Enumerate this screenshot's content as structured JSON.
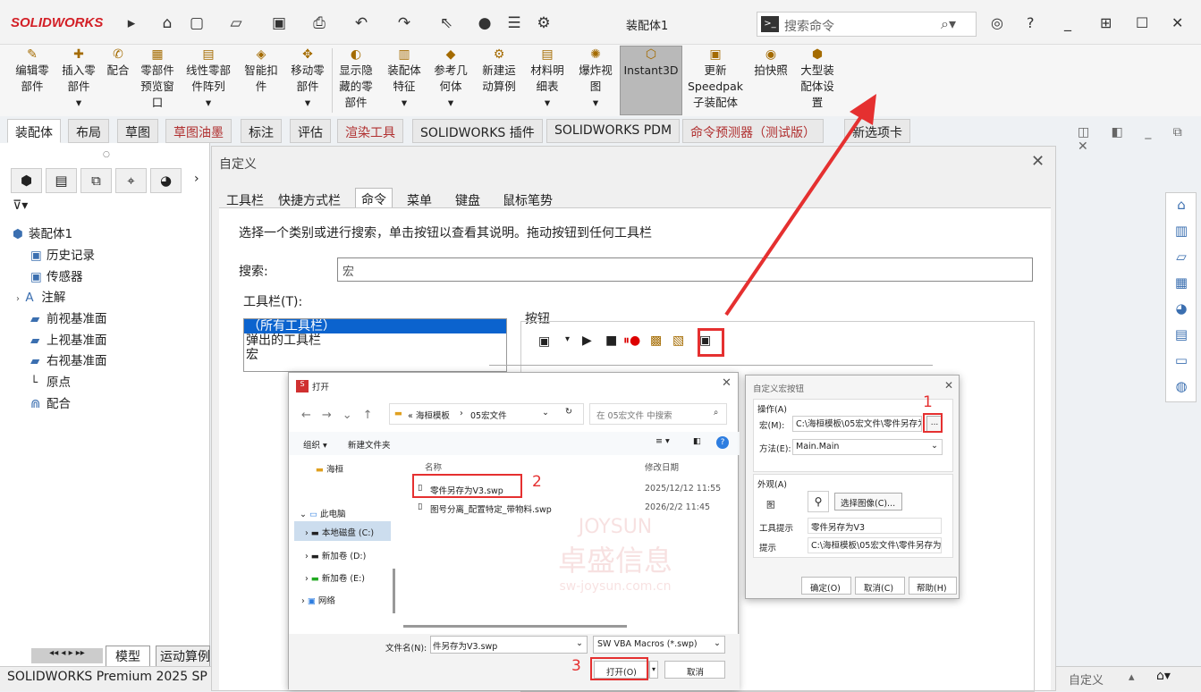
{
  "titlebar": {
    "logo": "SOLIDWORKS",
    "doc_title": "装配体1",
    "search_placeholder": "搜索命令"
  },
  "ribbon": [
    {
      "l1": "编辑零",
      "l2": "部件",
      "l3": ""
    },
    {
      "l1": "插入零",
      "l2": "部件",
      "l3": "▾"
    },
    {
      "l1": "配合",
      "l2": "",
      "l3": ""
    },
    {
      "l1": "零部件",
      "l2": "预览窗",
      "l3": "口"
    },
    {
      "l1": "线性零部",
      "l2": "件阵列",
      "l3": "▾"
    },
    {
      "l1": "智能扣",
      "l2": "件",
      "l3": ""
    },
    {
      "l1": "移动零",
      "l2": "部件",
      "l3": "▾"
    },
    {
      "l1": "显示隐",
      "l2": "藏的零",
      "l3": "部件"
    },
    {
      "l1": "装配体",
      "l2": "特征",
      "l3": "▾"
    },
    {
      "l1": "参考几",
      "l2": "何体",
      "l3": "▾"
    },
    {
      "l1": "新建运",
      "l2": "动算例",
      "l3": ""
    },
    {
      "l1": "材料明",
      "l2": "细表",
      "l3": "▾"
    },
    {
      "l1": "爆炸视",
      "l2": "图",
      "l3": "▾"
    },
    {
      "l1": "Instant3D",
      "l2": "",
      "l3": ""
    },
    {
      "l1": "更新",
      "l2": "Speedpak",
      "l3": "子装配体"
    },
    {
      "l1": "拍快照",
      "l2": "",
      "l3": ""
    },
    {
      "l1": "大型装",
      "l2": "配体设",
      "l3": "置"
    }
  ],
  "tabs": [
    "装配体",
    "布局",
    "草图",
    "草图油墨",
    "标注",
    "评估",
    "渲染工具",
    "SOLIDWORKS 插件",
    "SOLIDWORKS PDM",
    "命令预测器（测试版）",
    "新选项卡"
  ],
  "tree": {
    "root": "装配体1",
    "items": [
      "历史记录",
      "传感器",
      "注解",
      "前视基准面",
      "上视基准面",
      "右视基准面",
      "原点",
      "配合"
    ]
  },
  "bottom_tabs": [
    "模型",
    "运动算例"
  ],
  "status": {
    "product": "SOLIDWORKS Premium 2025 SP",
    "mode": "自定义"
  },
  "customize": {
    "title": "自定义",
    "tabs": [
      "工具栏",
      "快捷方式栏",
      "命令",
      "菜单",
      "键盘",
      "鼠标笔势"
    ],
    "instruction": "选择一个类别或进行搜索，单击按钮以查看其说明。拖动按钮到任何工具栏",
    "search_label": "搜索:",
    "search_value": "宏",
    "toolbar_label": "工具栏(T):",
    "list": [
      "（所有工具栏）",
      "弹出的工具栏",
      "宏"
    ],
    "buttons_label": "按钮"
  },
  "open_dialog": {
    "title": "打开",
    "path": [
      "« 海桓模板",
      "05宏文件"
    ],
    "search_placeholder": "在 05宏文件 中搜索",
    "organize": "组织 ▾",
    "new_folder": "新建文件夹",
    "col_name": "名称",
    "col_date": "修改日期",
    "nav": [
      "海桓",
      "此电脑",
      "本地磁盘 (C:)",
      "新加卷 (D:)",
      "新加卷 (E:)",
      "网络"
    ],
    "files": [
      {
        "name": "零件另存为V3.swp",
        "date": "2025/12/12 11:55"
      },
      {
        "name": "图号分离_配置特定_带物料.swp",
        "date": "2026/2/2 11:45"
      }
    ],
    "filename_label": "文件名(N):",
    "filename_value": "件另存为V3.swp",
    "filter": "SW VBA Macros (*.swp)",
    "open_btn": "打开(O)",
    "cancel_btn": "取消"
  },
  "macro_dialog": {
    "title": "自定义宏按钮",
    "action": "操作(A)",
    "macro_label": "宏(M):",
    "macro_value": "C:\\海桓模板\\05宏文件\\零件另存为",
    "method_label": "方法(E):",
    "method_value": "Main.Main",
    "appearance": "外观(A)",
    "image_label": "图",
    "choose_image": "选择图像(C)...",
    "tooltip_label": "工具提示",
    "tooltip_value": "零件另存为V3",
    "prompt_label": "提示",
    "prompt_value": "C:\\海桓模板\\05宏文件\\零件另存为",
    "ok": "确定(O)",
    "cancel": "取消(C)",
    "help": "帮助(H)"
  },
  "annotations": {
    "n1": "1",
    "n2": "2",
    "n3": "3"
  },
  "watermark": {
    "cn": "卓盛信息",
    "en": "JOYSUN",
    "url": "sw-joysun.com.cn"
  },
  "colors": {
    "accent": "#e53030",
    "selection": "#0b63ce"
  }
}
